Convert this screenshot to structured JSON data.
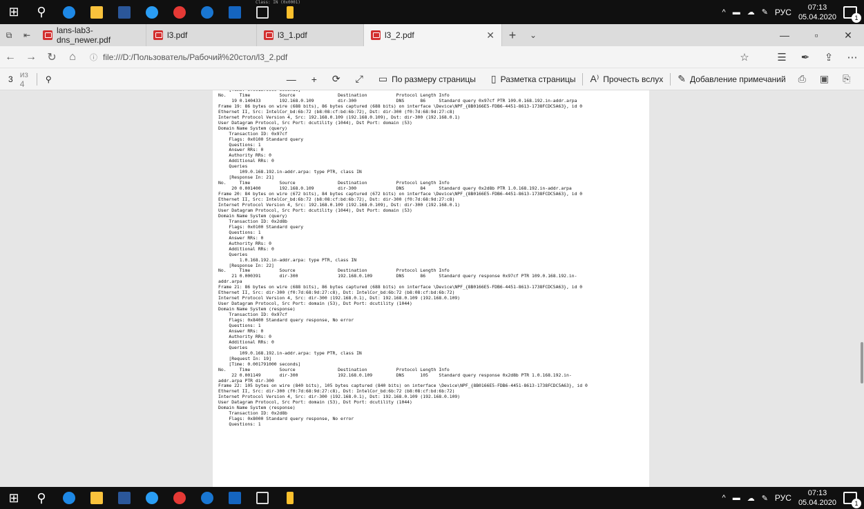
{
  "taskbar": {
    "time": "07:13",
    "date": "05.04.2020",
    "lang": "РУС",
    "notifications": "1",
    "icons": [
      "start-icon",
      "search-icon",
      "edge-icon",
      "file-explorer-icon",
      "word-icon",
      "app-icon",
      "chrome-icon",
      "ie-icon",
      "app-blue-icon",
      "tablet-icon",
      "pin-icon"
    ],
    "peek_text": "Class: IN (0x0001)"
  },
  "tabs": [
    {
      "label": "lans-lab3-dns_newer.pdf"
    },
    {
      "label": "l3.pdf"
    },
    {
      "label": "l3_1.pdf"
    },
    {
      "label": "l3_2.pdf"
    }
  ],
  "address": {
    "url": "file:///D:/Пользователь/Рабочий%20стол/l3_2.pdf"
  },
  "pdf_toolbar": {
    "page_current": "3",
    "page_total": "из 4",
    "fit_page": "По размеру страницы",
    "page_layout": "Разметка страницы",
    "read_aloud": "Прочесть вслух",
    "add_notes": "Добавление примечаний"
  },
  "document_lines": [
    "    [Time: 0.001579000 seconds]",
    "No.     Time           Source                Destination           Protocol Length Info",
    "     19 0.140433       192.168.0.109         dir-300               DNS      86     Standard query 0x97cf PTR 109.0.168.192.in-addr.arpa",
    "Frame 19: 86 bytes on wire (688 bits), 86 bytes captured (688 bits) on interface \\Device\\NPF_{8B0166E5-FDB6-4451-8613-1738FCDC5A63}, id 0",
    "Ethernet II, Src: IntelCor_bd:6b:72 (b8:08:cf:bd:6b:72), Dst: dir-300 (f0:7d:68:9d:27:c8)",
    "Internet Protocol Version 4, Src: 192.168.0.109 (192.168.0.109), Dst: dir-300 (192.168.0.1)",
    "User Datagram Protocol, Src Port: dcutility (1044), Dst Port: domain (53)",
    "Domain Name System (query)",
    "    Transaction ID: 0x97cf",
    "    Flags: 0x0100 Standard query",
    "    Questions: 1",
    "    Answer RRs: 0",
    "    Authority RRs: 0",
    "    Additional RRs: 0",
    "    Queries",
    "        109.0.168.192.in-addr.arpa: type PTR, class IN",
    "    [Response In: 21]",
    "No.     Time           Source                Destination           Protocol Length Info",
    "     20 0.001400       192.168.0.109         dir-300               DNS      84     Standard query 0x2d8b PTR 1.0.168.192.in-addr.arpa",
    "Frame 20: 84 bytes on wire (672 bits), 84 bytes captured (672 bits) on interface \\Device\\NPF_{8B0166E5-FDB6-4451-8613-1738FCDC5A63}, id 0",
    "Ethernet II, Src: IntelCor_bd:6b:72 (b8:08:cf:bd:6b:72), Dst: dir-300 (f0:7d:68:9d:27:c8)",
    "Internet Protocol Version 4, Src: 192.168.0.109 (192.168.0.109), Dst: dir-300 (192.168.0.1)",
    "User Datagram Protocol, Src Port: dcutility (1044), Dst Port: domain (53)",
    "Domain Name System (query)",
    "    Transaction ID: 0x2d8b",
    "    Flags: 0x0100 Standard query",
    "    Questions: 1",
    "    Answer RRs: 0",
    "    Authority RRs: 0",
    "    Additional RRs: 0",
    "    Queries",
    "        1.0.168.192.in-addr.arpa: type PTR, class IN",
    "    [Response In: 22]",
    "No.     Time           Source                Destination           Protocol Length Info",
    "     21 0.000391       dir-300               192.168.0.109         DNS      86     Standard query response 0x97cf PTR 109.0.168.192.in-",
    "addr.arpa",
    "Frame 21: 86 bytes on wire (688 bits), 86 bytes captured (688 bits) on interface \\Device\\NPF_{8B0166E5-FDB6-4451-8613-1738FCDC5A63}, id 0",
    "Ethernet II, Src: dir-300 (f0:7d:68:9d:27:c8), Dst: IntelCor_bd:6b:72 (b8:08:cf:bd:6b:72)",
    "Internet Protocol Version 4, Src: dir-300 (192.168.0.1), Dst: 192.168.0.109 (192.168.0.109)",
    "User Datagram Protocol, Src Port: domain (53), Dst Port: dcutility (1044)",
    "Domain Name System (response)",
    "    Transaction ID: 0x97cf",
    "    Flags: 0x8400 Standard query response, No error",
    "    Questions: 1",
    "    Answer RRs: 0",
    "    Authority RRs: 0",
    "    Additional RRs: 0",
    "    Queries",
    "        109.0.168.192.in-addr.arpa: type PTR, class IN",
    "    [Request In: 19]",
    "    [Time: 0.001791000 seconds]",
    "No.     Time           Source                Destination           Protocol Length Info",
    "     22 0.001149       dir-300               192.168.0.109         DNS      105    Standard query response 0x2d8b PTR 1.0.168.192.in-",
    "addr.arpa PTR dir-300",
    "Frame 22: 105 bytes on wire (840 bits), 105 bytes captured (840 bits) on interface \\Device\\NPF_{8B0166E5-FDB6-4451-8613-1738FCDC5A63}, id 0",
    "Ethernet II, Src: dir-300 (f0:7d:68:9d:27:c8), Dst: IntelCor_bd:6b:72 (b8:08:cf:bd:6b:72)",
    "Internet Protocol Version 4, Src: dir-300 (192.168.0.1), Dst: 192.168.0.109 (192.168.0.109)",
    "User Datagram Protocol, Src Port: domain (53), Dst Port: dcutility (1044)",
    "Domain Name System (response)",
    "    Transaction ID: 0x2d8b",
    "    Flags: 0x8000 Standard query response, No error",
    "    Questions: 1"
  ]
}
